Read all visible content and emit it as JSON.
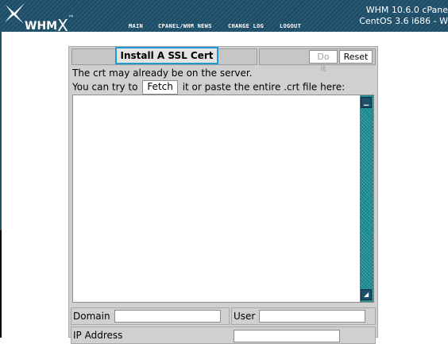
{
  "header": {
    "brand": "WHM",
    "brand_x": "X",
    "brand_tm": "™",
    "nav": [
      "main",
      "cpanel/whm news",
      "change log",
      "logout"
    ],
    "version_line1": "WHM 10.6.0 cPane",
    "version_line2": "CentOS 3.6 i686 - W"
  },
  "panel": {
    "title": "Install A SSL Cert",
    "doit_label": "Do it",
    "reset_label": "Reset",
    "message_line1": "The crt may already be on the server.",
    "message_line2_pre": "You can try to",
    "fetch_label": "Fetch",
    "message_line2_post": "it or paste the entire .crt file here:",
    "textarea_value": "",
    "domain_label": "Domain",
    "domain_value": "",
    "user_label": "User",
    "user_value": "",
    "ip_label": "IP Address",
    "ip_value": ""
  },
  "colors": {
    "header_bg": "#1e4f6a",
    "panel_bg": "#d0d0d0",
    "title_highlight": "#1e9bd6",
    "scrollbar": "#1a8f94"
  }
}
